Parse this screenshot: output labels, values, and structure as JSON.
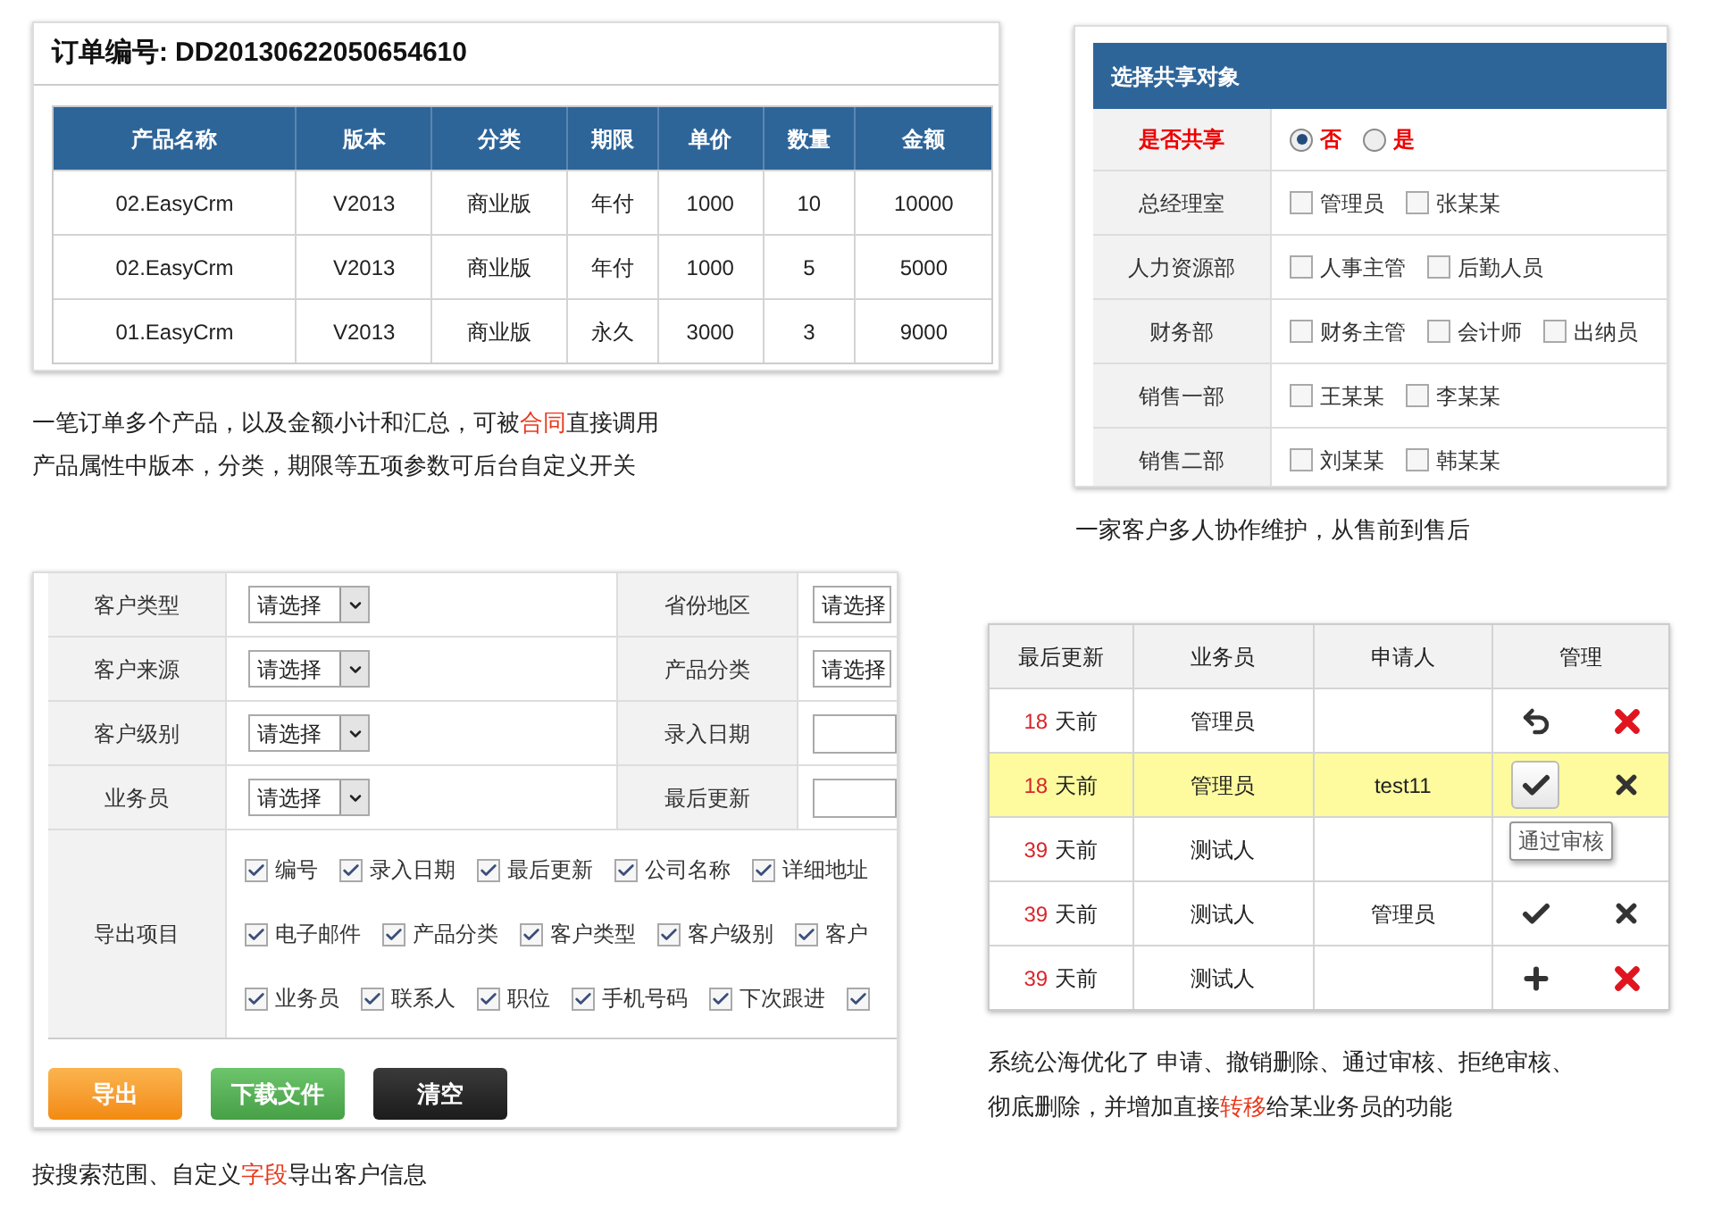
{
  "order_panel": {
    "title_label": "订单编号:",
    "order_no": "DD20130622050654610",
    "columns": [
      "产品名称",
      "版本",
      "分类",
      "期限",
      "单价",
      "数量",
      "金额"
    ],
    "rows": [
      [
        "02.EasyCrm",
        "V2013",
        "商业版",
        "年付",
        "1000",
        "10",
        "10000"
      ],
      [
        "02.EasyCrm",
        "V2013",
        "商业版",
        "年付",
        "1000",
        "5",
        "5000"
      ],
      [
        "01.EasyCrm",
        "V2013",
        "商业版",
        "永久",
        "3000",
        "3",
        "9000"
      ]
    ]
  },
  "order_caption": [
    [
      {
        "text": "一笔订单多个产品，以及金额小计和汇总，可被",
        "highlight": false
      },
      {
        "text": "合同",
        "highlight": true
      },
      {
        "text": "直接调用",
        "highlight": false
      }
    ],
    [
      {
        "text": "产品属性中版本，分类，期限等五项参数可后台自定义开关",
        "highlight": false
      }
    ]
  ],
  "share_panel": {
    "title": "选择共享对象",
    "share_label": "是否共享",
    "options": [
      {
        "label": "否",
        "selected": true
      },
      {
        "label": "是",
        "selected": false
      }
    ],
    "groups": [
      {
        "dept": "总经理室",
        "members": [
          {
            "name": "管理员",
            "checked": false
          },
          {
            "name": "张某某",
            "checked": false
          }
        ]
      },
      {
        "dept": "人力资源部",
        "members": [
          {
            "name": "人事主管",
            "checked": false
          },
          {
            "name": "后勤人员",
            "checked": false
          }
        ]
      },
      {
        "dept": "财务部",
        "members": [
          {
            "name": "财务主管",
            "checked": false
          },
          {
            "name": "会计师",
            "checked": false
          },
          {
            "name": "出纳员",
            "checked": false
          }
        ]
      },
      {
        "dept": "销售一部",
        "members": [
          {
            "name": "王某某",
            "checked": false
          },
          {
            "name": "李某某",
            "checked": false
          }
        ]
      },
      {
        "dept": "销售二部",
        "members": [
          {
            "name": "刘某某",
            "checked": false
          },
          {
            "name": "韩某某",
            "checked": false
          }
        ]
      }
    ]
  },
  "share_caption": [
    [
      {
        "text": "一家客户多人协作维护，从售前到售后",
        "highlight": false
      }
    ]
  ],
  "export_panel": {
    "filters": [
      {
        "left": {
          "label": "客户类型",
          "kind": "select",
          "value": "请选择"
        },
        "right": {
          "label": "省份地区",
          "kind": "select",
          "value": "请选择"
        }
      },
      {
        "left": {
          "label": "客户来源",
          "kind": "select",
          "value": "请选择"
        },
        "right": {
          "label": "产品分类",
          "kind": "select",
          "value": "请选择"
        }
      },
      {
        "left": {
          "label": "客户级别",
          "kind": "select",
          "value": "请选择"
        },
        "right": {
          "label": "录入日期",
          "kind": "date"
        }
      },
      {
        "left": {
          "label": "业务员",
          "kind": "select",
          "value": "请选择"
        },
        "right": {
          "label": "最后更新",
          "kind": "date"
        }
      }
    ],
    "fields_label": "导出项目",
    "field_rows": [
      [
        {
          "label": "编号",
          "checked": true
        },
        {
          "label": "录入日期",
          "checked": true
        },
        {
          "label": "最后更新",
          "checked": true
        },
        {
          "label": "公司名称",
          "checked": true
        },
        {
          "label": "详细地址",
          "checked": true
        }
      ],
      [
        {
          "label": "电子邮件",
          "checked": true
        },
        {
          "label": "产品分类",
          "checked": true
        },
        {
          "label": "客户类型",
          "checked": true
        },
        {
          "label": "客户级别",
          "checked": true
        },
        {
          "label": "客户",
          "checked": true
        }
      ],
      [
        {
          "label": "业务员",
          "checked": true
        },
        {
          "label": "联系人",
          "checked": true
        },
        {
          "label": "职位",
          "checked": true
        },
        {
          "label": "手机号码",
          "checked": true
        },
        {
          "label": "下次跟进",
          "checked": true
        },
        {
          "checked": true
        }
      ]
    ],
    "buttons": [
      {
        "label": "导出",
        "kind": "orange"
      },
      {
        "label": "下载文件",
        "kind": "green"
      },
      {
        "label": "清空",
        "kind": "dark"
      }
    ]
  },
  "export_caption": [
    [
      {
        "text": "按搜索范围、自定义",
        "highlight": false
      },
      {
        "text": "字段",
        "highlight": true
      },
      {
        "text": "导出客户信息",
        "highlight": false
      }
    ]
  ],
  "pool_table": {
    "columns": [
      "最后更新",
      "业务员",
      "申请人",
      "管理"
    ],
    "rows": [
      {
        "days": "18",
        "unit": "天前",
        "staff": "管理员",
        "highlighted": false,
        "actions": [
          {
            "kind": "undo",
            "hovered": false
          },
          {
            "kind": "delete",
            "hovered": false
          }
        ]
      },
      {
        "days": "18",
        "unit": "天前",
        "staff": "管理员",
        "applicant": "test11",
        "highlighted": true,
        "actions": [
          {
            "kind": "approve",
            "hovered": true,
            "tooltip": "通过审核"
          },
          {
            "kind": "reject",
            "hovered": false
          }
        ]
      },
      {
        "days": "39",
        "unit": "天前",
        "staff": "测试人",
        "highlighted": false,
        "actions": []
      },
      {
        "days": "39",
        "unit": "天前",
        "staff": "测试人",
        "applicant": "管理员",
        "highlighted": false,
        "actions": [
          {
            "kind": "approve",
            "hovered": false
          },
          {
            "kind": "reject",
            "hovered": false
          }
        ]
      },
      {
        "days": "39",
        "unit": "天前",
        "staff": "测试人",
        "highlighted": false,
        "actions": [
          {
            "kind": "add",
            "hovered": false
          },
          {
            "kind": "delete",
            "hovered": false
          }
        ]
      }
    ]
  },
  "pool_caption": [
    [
      {
        "text": "系统公海优化了 申请、撤销删除、通过审核、拒绝审核、",
        "highlight": false
      }
    ],
    [
      {
        "text": "彻底删除，并增加直接",
        "highlight": false
      },
      {
        "text": "转移",
        "highlight": true
      },
      {
        "text": "给某业务员的功能",
        "highlight": false
      }
    ]
  ]
}
